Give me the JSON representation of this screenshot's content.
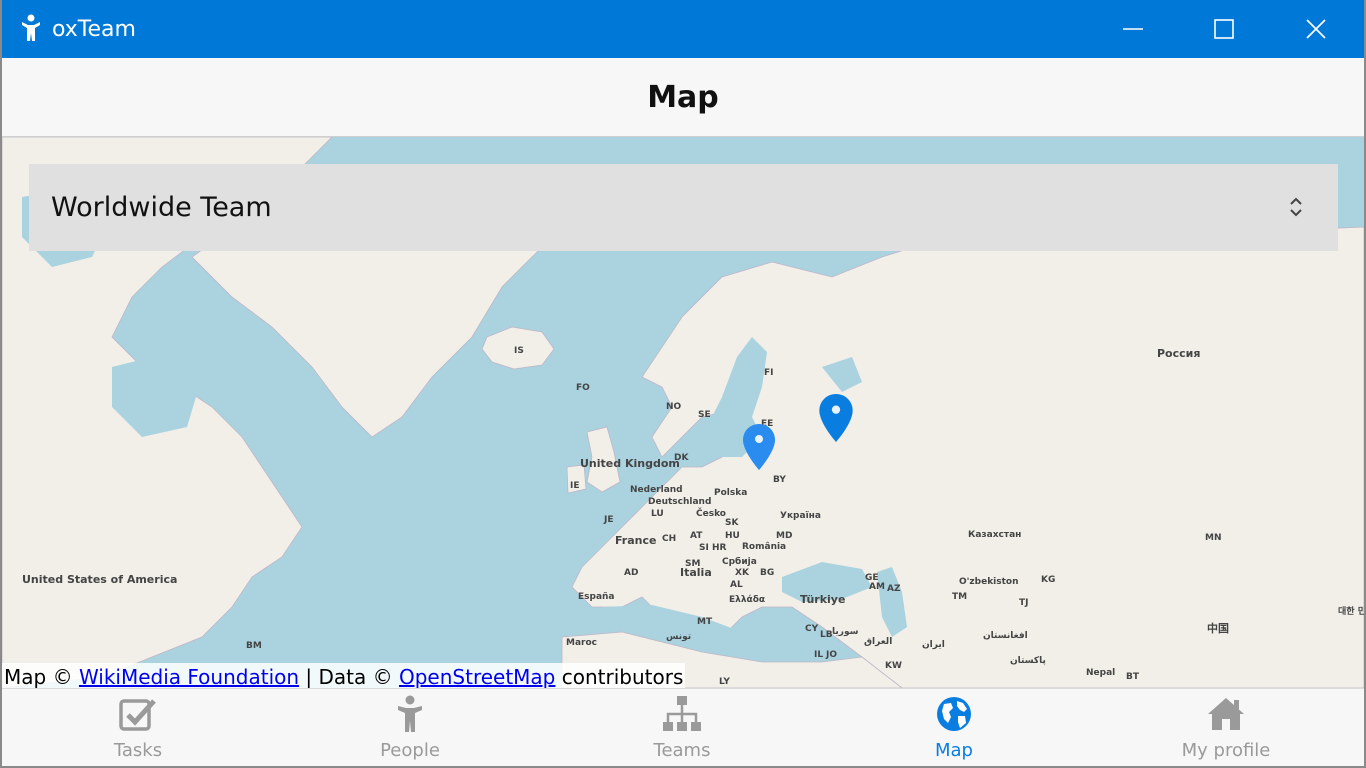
{
  "window": {
    "app_title": "oxTeam",
    "accent_color": "#0078d7",
    "controls": {
      "minimize_icon": "minimize-icon",
      "maximize_icon": "maximize-icon",
      "close_icon": "close-icon"
    }
  },
  "header": {
    "title": "Map"
  },
  "team_select": {
    "value": "Worldwide Team",
    "icon": "chevron-updown-icon"
  },
  "map": {
    "labels": {
      "is": "IS",
      "fo": "FO",
      "no": "NO",
      "se": "SE",
      "fi": "FI",
      "ee": "EE",
      "dk": "DK",
      "uk": "United Kingdom",
      "ie": "IE",
      "nl": "Nederland",
      "de": "Deutschland",
      "pl": "Polska",
      "by": "BY",
      "lu": "LU",
      "cz": "Česko",
      "sk": "SK",
      "ua": "Україна",
      "je": "JE",
      "fr": "France",
      "ch": "CH",
      "at": "AT",
      "hu": "HU",
      "md": "MD",
      "si": "SI",
      "hr": "HR",
      "ro": "România",
      "sm": "SM",
      "rs": "Србија",
      "ad": "AD",
      "it": "Italia",
      "xk": "XK",
      "bg": "BG",
      "al": "AL",
      "gr": "Ελλάδα",
      "es": "España",
      "mt": "MT",
      "tr": "Türkiye",
      "ma": "Maroc",
      "tn": "تونس",
      "cy": "CY",
      "lb": "LB",
      "il": "IL",
      "jo": "JO",
      "sy": "سوريا",
      "iq": "العراق",
      "ir": "ایران",
      "ge": "GE",
      "am": "AM",
      "az": "AZ",
      "kw": "KW",
      "ly": "LY",
      "ru": "Россия",
      "kz": "Казахстан",
      "uz": "O'zbekiston",
      "kg": "KG",
      "tm": "TM",
      "tj": "TJ",
      "af": "افغانستان",
      "pk": "پاکستان",
      "np": "Nepal",
      "bt": "BT",
      "mn": "MN",
      "cn": "中国",
      "kr": "대한 민국",
      "us": "United States of America",
      "bm": "BM"
    },
    "markers": [
      {
        "name": "marker-1",
        "color": "#2b8cf0"
      },
      {
        "name": "marker-2",
        "color": "#0a7ee0"
      }
    ],
    "attribution": {
      "prefix": "Map ©",
      "wikimedia": "WikiMedia Foundation",
      "middle": "| Data ©",
      "osm": "OpenStreetMap",
      "suffix": "contributors"
    }
  },
  "bottom_nav": {
    "items": [
      {
        "label": "Tasks",
        "icon": "tasks-checkbox-icon",
        "active": false
      },
      {
        "label": "People",
        "icon": "person-icon",
        "active": false
      },
      {
        "label": "Teams",
        "icon": "org-chart-icon",
        "active": false
      },
      {
        "label": "Map",
        "icon": "globe-icon",
        "active": true
      },
      {
        "label": "My profile",
        "icon": "home-icon",
        "active": false
      }
    ],
    "active_color": "#0a7ee0",
    "inactive_color": "#9a9a9a"
  }
}
